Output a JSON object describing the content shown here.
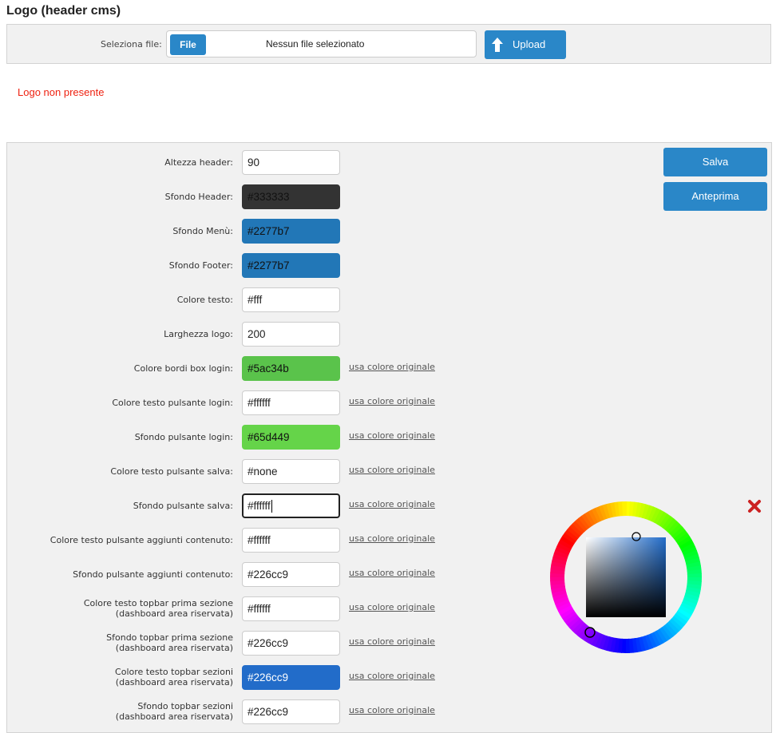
{
  "header": {
    "title": "Logo (header cms)"
  },
  "upload": {
    "label": "Seleziona file:",
    "file_button": "File",
    "file_status": "Nessun file selezionato",
    "upload_button": "Upload",
    "upload_icon": "arrow-up-icon"
  },
  "logo_status": {
    "text": "Logo non presente",
    "color": "#ee2211"
  },
  "actions": {
    "save": "Salva",
    "preview": "Anteprima"
  },
  "fields": [
    {
      "label": "Altezza header:",
      "value": "90"
    },
    {
      "label": "Sfondo Header:",
      "value": "#333333",
      "bg": "#333333",
      "fg": "#111111"
    },
    {
      "label": "Sfondo Menù:",
      "value": "#2277b7",
      "bg": "#2277b7",
      "fg": "#111111"
    },
    {
      "label": "Sfondo Footer:",
      "value": "#2277b7",
      "bg": "#2277b7",
      "fg": "#111111"
    },
    {
      "label": "Colore testo:",
      "value": "#fff"
    },
    {
      "label": "Larghezza logo:",
      "value": "200"
    },
    {
      "label": "Colore bordi box login:",
      "value": "#5ac34b",
      "bg": "#5ac34b",
      "fg": "#111111",
      "link": "usa colore originale"
    },
    {
      "label": "Colore testo pulsante login:",
      "value": "#ffffff",
      "link": "usa colore originale"
    },
    {
      "label": "Sfondo pulsante login:",
      "value": "#65d449",
      "bg": "#65d449",
      "fg": "#111111",
      "link": "usa colore originale"
    },
    {
      "label": "Colore testo pulsante salva:",
      "value": "#none",
      "link": "usa colore originale"
    },
    {
      "label": "Sfondo pulsante salva:",
      "value": "#ffffff",
      "focused": true,
      "link": "usa colore originale"
    },
    {
      "label": "Colore testo pulsante aggiunti contenuto:",
      "value": "#ffffff",
      "link": "usa colore originale"
    },
    {
      "label": "Sfondo pulsante aggiunti contenuto:",
      "value": "#226cc9",
      "link": "usa colore originale"
    },
    {
      "label": "Colore testo topbar prima sezione",
      "label2": "(dashboard area riservata)",
      "value": "#ffffff",
      "link": "usa colore originale"
    },
    {
      "label": "Sfondo topbar prima sezione",
      "label2": "(dashboard area riservata)",
      "value": "#226cc9",
      "link": "usa colore originale"
    },
    {
      "label": "Colore testo topbar sezioni",
      "label2": "(dashboard area riservata)",
      "value": "#226cc9",
      "bg": "#226cc9",
      "fg": "#ffffff",
      "link": "usa colore originale"
    },
    {
      "label": "Sfondo topbar sezioni",
      "label2": "(dashboard area riservata)",
      "value": "#226cc9",
      "link": "usa colore originale"
    }
  ],
  "color_picker": {
    "close_icon": "close-x-icon",
    "close_color": "#cc2222",
    "square_hue": "#226cc9"
  }
}
